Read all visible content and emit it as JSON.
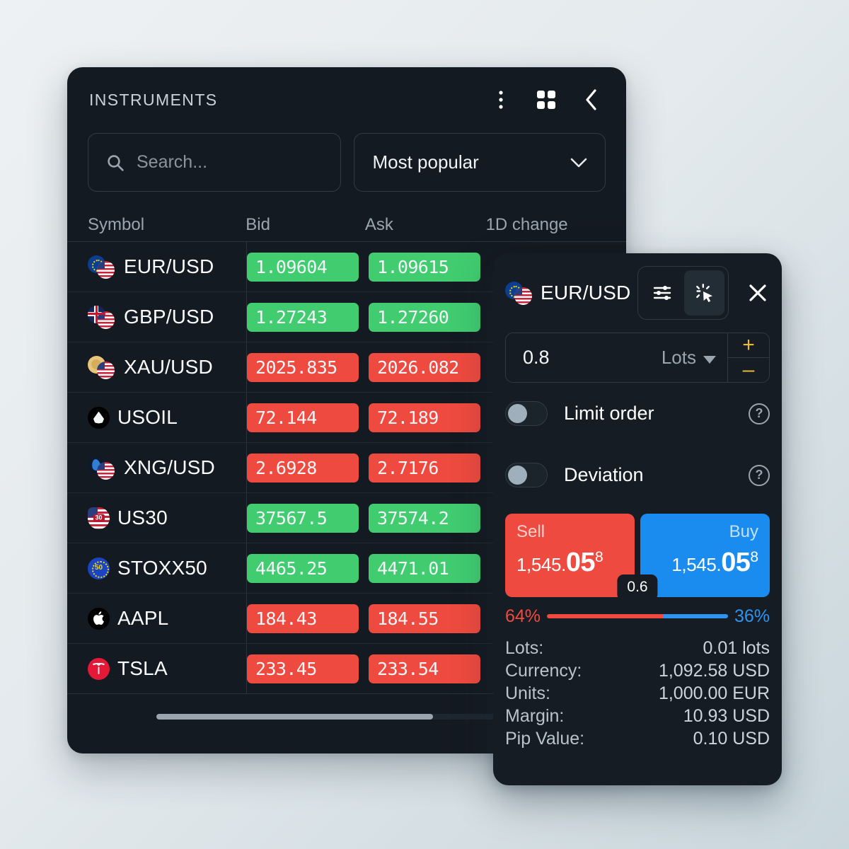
{
  "theme": {
    "page_bg_top": "#eef1f3",
    "page_bg_bottom": "#c9d6dc",
    "panel_bg": "#141a21",
    "trade_panel_bg": "#151c23",
    "up_color": "#41cc70",
    "down_color": "#ef4a3f",
    "buy_color": "#1a8cf0",
    "sell_color": "#ef4a3f",
    "accent_amber": "#e8b93a"
  },
  "instruments": {
    "title": "INSTRUMENTS",
    "actions": [
      {
        "name": "more-options",
        "icon": "kebab-menu-icon"
      },
      {
        "name": "grid-view",
        "icon": "grid-icon"
      },
      {
        "name": "collapse",
        "icon": "chevron-left-icon"
      }
    ],
    "search": {
      "placeholder": "Search...",
      "value": "",
      "icon": "search-icon"
    },
    "filter": {
      "value": "Most popular",
      "icon": "chevron-down-icon"
    },
    "columns": {
      "symbol": "Symbol",
      "bid": "Bid",
      "ask": "Ask",
      "change": "1D change"
    },
    "rows": [
      {
        "symbol": "EUR/USD",
        "bid": "1.09604",
        "ask": "1.09615",
        "dir": "up",
        "icon": "flag-pair-eu-us"
      },
      {
        "symbol": "GBP/USD",
        "bid": "1.27243",
        "ask": "1.27260",
        "dir": "up",
        "icon": "flag-pair-gb-us"
      },
      {
        "symbol": "XAU/USD",
        "bid": "2025.835",
        "ask": "2026.082",
        "dir": "down",
        "icon": "gold-us-icon"
      },
      {
        "symbol": "USOIL",
        "bid": "72.144",
        "ask": "72.189",
        "dir": "down",
        "icon": "oil-drop-icon"
      },
      {
        "symbol": "XNG/USD",
        "bid": "2.6928",
        "ask": "2.7176",
        "dir": "down",
        "icon": "gas-flame-us-icon"
      },
      {
        "symbol": "US30",
        "bid": "37567.5",
        "ask": "37574.2",
        "dir": "up",
        "icon": "us30-flag-icon"
      },
      {
        "symbol": "STOXX50",
        "bid": "4465.25",
        "ask": "4471.01",
        "dir": "up",
        "icon": "stoxx50-icon"
      },
      {
        "symbol": "AAPL",
        "bid": "184.43",
        "ask": "184.55",
        "dir": "down",
        "icon": "apple-logo-icon"
      },
      {
        "symbol": "TSLA",
        "bid": "233.45",
        "ask": "233.54",
        "dir": "down",
        "icon": "tesla-logo-icon"
      }
    ],
    "scrollbar": {
      "name": "horizontal-scrollbar",
      "thumb_percent": "62"
    }
  },
  "trade": {
    "symbol": "EUR/USD",
    "symbol_icon": "flag-pair-eu-us",
    "view_modes": [
      {
        "name": "sliders-view",
        "icon": "sliders-icon",
        "active": false
      },
      {
        "name": "one-click-view",
        "icon": "click-cursor-icon",
        "active": true
      }
    ],
    "close_icon": "close-icon",
    "volume": {
      "value": "0.8",
      "unit": "Lots",
      "unit_icon": "caret-down-icon",
      "increment": "+",
      "decrement": "–"
    },
    "options": [
      {
        "label": "Limit order",
        "enabled": false,
        "help_icon": "help-circle-icon"
      },
      {
        "label": "Deviation",
        "enabled": false,
        "help_icon": "help-circle-icon"
      }
    ],
    "sell": {
      "label": "Sell",
      "price_prefix": "1,545.",
      "price_main": "05",
      "price_sup": "8"
    },
    "buy": {
      "label": "Buy",
      "price_prefix": "1,545.",
      "price_main": "05",
      "price_sup": "8"
    },
    "spread": "0.6",
    "sentiment": {
      "sell_percent": "64%",
      "buy_percent": "36%",
      "sell_value": 64,
      "buy_value": 36
    },
    "details": [
      {
        "key": "Lots:",
        "value": "0.01 lots"
      },
      {
        "key": "Currency:",
        "value": "1,092.58 USD"
      },
      {
        "key": "Units:",
        "value": "1,000.00 EUR"
      },
      {
        "key": "Margin:",
        "value": "10.93 USD"
      },
      {
        "key": "Pip Value:",
        "value": "0.10 USD"
      }
    ]
  }
}
